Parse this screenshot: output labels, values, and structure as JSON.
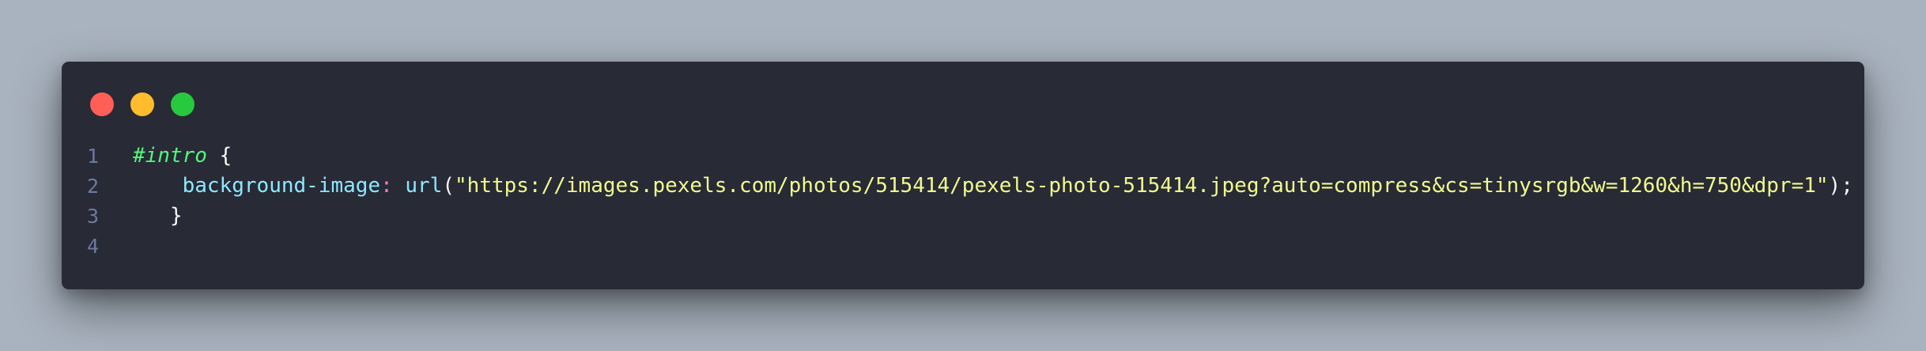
{
  "window": {
    "controls": [
      {
        "name": "close",
        "color": "#ff5f56"
      },
      {
        "name": "minimize",
        "color": "#ffbd2e"
      },
      {
        "name": "maximize",
        "color": "#27c93f"
      }
    ]
  },
  "code": {
    "lines": [
      {
        "number": "1",
        "tokens": {
          "selector": "#intro",
          "space": " ",
          "brace_open": "{"
        }
      },
      {
        "number": "2",
        "tokens": {
          "indent": "    ",
          "property": "background-image",
          "colon": ":",
          "space": " ",
          "function": "url",
          "paren_open": "(",
          "string": "\"https://images.pexels.com/photos/515414/pexels-photo-515414.jpeg?auto=compress&cs=tinysrgb&w=1260&h=750&dpr=1\"",
          "paren_close": ")",
          "semicolon": ";"
        }
      },
      {
        "number": "3",
        "tokens": {
          "indent": "   ",
          "brace_close": "}"
        }
      },
      {
        "number": "4",
        "tokens": {}
      }
    ]
  }
}
